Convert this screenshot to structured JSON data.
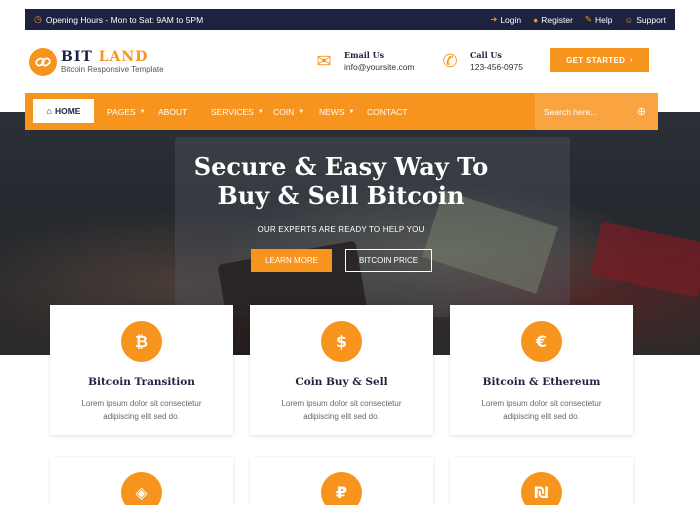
{
  "topbar": {
    "hours": "Opening Hours - Mon to Sat: 9AM to 5PM",
    "login": "Login",
    "register": "Register",
    "help": "Help",
    "support": "Support"
  },
  "brand": {
    "name_part1": "BIT",
    "name_part2": "LAND",
    "tagline": "Bitcoin Responsive Template"
  },
  "contact": {
    "email_label": "Email Us",
    "email_value": "info@yoursite.com",
    "phone_label": "Call Us",
    "phone_value": "123-456-0975"
  },
  "cta": {
    "label": "GET STARTED"
  },
  "nav": {
    "home": "HOME",
    "items": [
      "PAGES",
      "ABOUT",
      "SERVICES",
      "COIN",
      "NEWS",
      "CONTACT"
    ],
    "search_placeholder": "Search here..."
  },
  "hero": {
    "title_line1": "Secure & Easy Way To",
    "title_line2": "Buy & Sell Bitcoin",
    "subtitle": "OUR EXPERTS ARE READY TO HELP YOU",
    "learn_more": "LEARN MORE",
    "bitcoin_price": "BITCOIN PRICE"
  },
  "features": [
    {
      "icon": "₿",
      "title": "Bitcoin Transition",
      "text": "Lorem ipsum dolor sit consectetur adipiscing elit sed do."
    },
    {
      "icon": "$",
      "title": "Coin Buy & Sell",
      "text": "Lorem ipsum dolor sit consectetur adipiscing elit sed do."
    },
    {
      "icon": "€",
      "title": "Bitcoin & Ethereum",
      "text": "Lorem ipsum dolor sit consectetur adipiscing elit sed do."
    }
  ],
  "features_row2": [
    {
      "icon": "◈"
    },
    {
      "icon": "₽"
    },
    {
      "icon": "₪"
    }
  ],
  "colors": {
    "accent": "#f7941d",
    "navy": "#1d2240"
  }
}
